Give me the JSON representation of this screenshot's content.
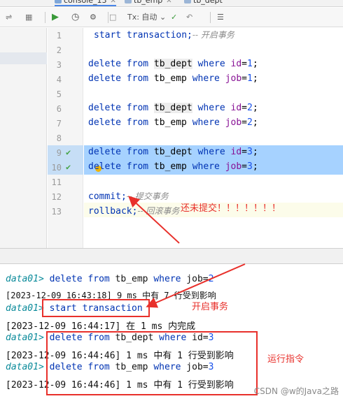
{
  "tabs": [
    {
      "label": "console_13",
      "active": true
    },
    {
      "label": "tb_emp",
      "active": false
    },
    {
      "label": "tb_dept",
      "active": false
    }
  ],
  "toolbar": {
    "tx_mode": "Tx: 自动"
  },
  "editor": {
    "lines": [
      {
        "n": "1",
        "code": "start transaction;",
        "comment": "-- 开启事务"
      },
      {
        "n": "2",
        "code": ""
      },
      {
        "n": "3",
        "pre": "delete from ",
        "tbl": "tb_dept",
        "mid": " where ",
        "col": "id",
        "val": "1"
      },
      {
        "n": "4",
        "pre": "delete from ",
        "tbl": "tb_emp",
        "mid": " where ",
        "col": "job",
        "val": "1"
      },
      {
        "n": "5",
        "code": ""
      },
      {
        "n": "6",
        "pre": "delete from ",
        "tbl": "tb_dept",
        "mid": " where ",
        "col": "id",
        "val": "2"
      },
      {
        "n": "7",
        "pre": "delete from ",
        "tbl": "tb_emp",
        "mid": " where ",
        "col": "job",
        "val": "2"
      },
      {
        "n": "8",
        "code": ""
      },
      {
        "n": "9",
        "pre": "delete from ",
        "tbl": "tb_dept",
        "mid": " where ",
        "col": "id",
        "val": "3",
        "checked": true,
        "selected": true
      },
      {
        "n": "10",
        "pre": "delete from ",
        "tbl": "tb_emp",
        "mid": " where ",
        "col": "job",
        "val": "3",
        "checked": true,
        "selected": true
      },
      {
        "n": "11",
        "code": ""
      },
      {
        "n": "12",
        "code": "commit;",
        "comment": "-- 提交事务"
      },
      {
        "n": "13",
        "code": "rollback;",
        "comment": "-- 回滚事务"
      }
    ]
  },
  "console": {
    "prompt": "data01>",
    "rows": [
      {
        "type": "cmd",
        "sql_kw1": "delete from",
        "sql_tbl": " tb_emp ",
        "sql_kw2": "where",
        "sql_rest": " job=",
        "sql_val": "2"
      },
      {
        "type": "out",
        "text": "[2023-12-09 16:43:18] 9 ms 中有 7 行受到影响"
      },
      {
        "type": "cmd",
        "sql_kw1": "start transaction",
        "sql_tbl": "",
        "sql_kw2": "",
        "sql_rest": "",
        "sql_val": ""
      },
      {
        "type": "out",
        "text": "[2023-12-09 16:44:17] 在 1 ms 内完成"
      },
      {
        "type": "cmd",
        "sql_kw1": "delete from",
        "sql_tbl": " tb_dept ",
        "sql_kw2": "where",
        "sql_rest": " id=",
        "sql_val": "3"
      },
      {
        "type": "out",
        "text": "[2023-12-09 16:44:46] 1 ms 中有 1 行受到影响"
      },
      {
        "type": "cmd",
        "sql_kw1": "delete from",
        "sql_tbl": " tb_emp ",
        "sql_kw2": "where",
        "sql_rest": " job=",
        "sql_val": "3"
      },
      {
        "type": "out",
        "text": "[2023-12-09 16:44:46] 1 ms 中有 1 行受到影响"
      }
    ]
  },
  "annotations": {
    "not_committed": "还未提交！！！！！！！",
    "start_tx": "开启事务",
    "run_cmd": "运行指令"
  },
  "watermark": "CSDN @w的Java之路",
  "colors": {
    "accent_red": "#e8302b",
    "selection": "#a6d2ff",
    "keyword": "#0033b3",
    "check_green": "#47a447"
  }
}
